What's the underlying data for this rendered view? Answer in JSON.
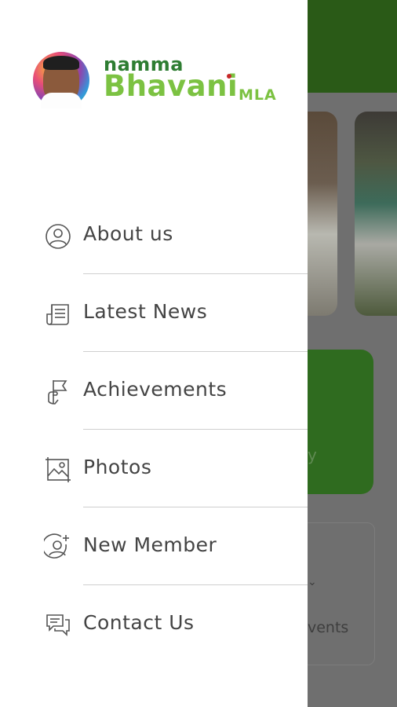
{
  "background": {
    "partial_text_card": "y",
    "partial_text_events": "vents"
  },
  "logo": {
    "line1": "namma",
    "line2": "Bhavani",
    "suffix": "MLA"
  },
  "menu": {
    "items": [
      {
        "label": "About us",
        "icon": "user-circle-icon"
      },
      {
        "label": "Latest News",
        "icon": "newspaper-icon"
      },
      {
        "label": "Achievements",
        "icon": "flag-hand-icon"
      },
      {
        "label": "Photos",
        "icon": "photo-icon"
      },
      {
        "label": "New Member",
        "icon": "add-user-icon"
      },
      {
        "label": "Contact Us",
        "icon": "chat-bubbles-icon"
      }
    ]
  }
}
